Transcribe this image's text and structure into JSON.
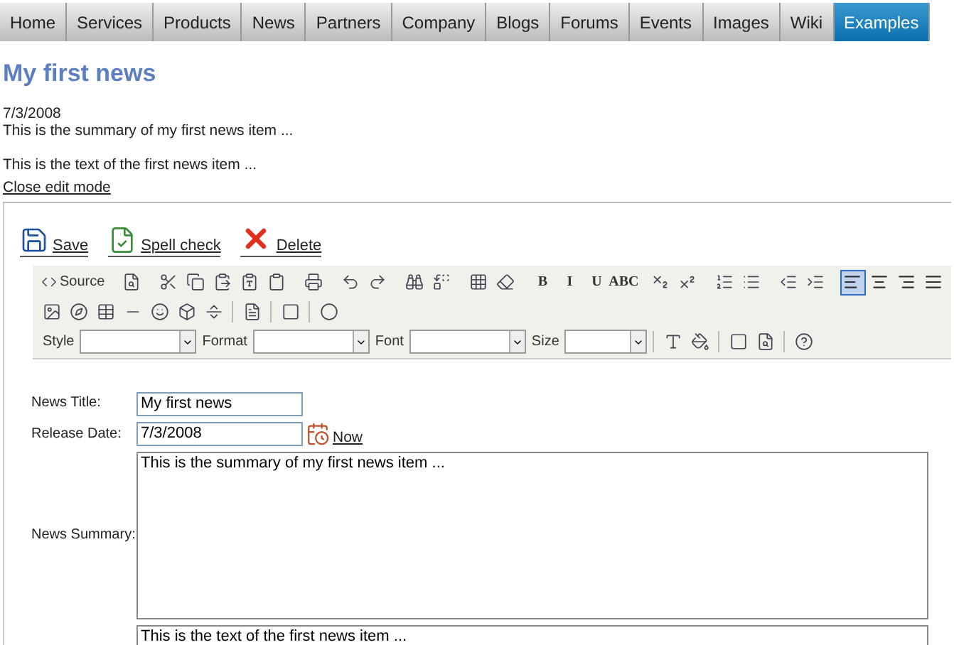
{
  "nav_tabs": [
    {
      "label": "Home",
      "selected": false
    },
    {
      "label": "Services",
      "selected": false
    },
    {
      "label": "Products",
      "selected": false
    },
    {
      "label": "News",
      "selected": false
    },
    {
      "label": "Partners",
      "selected": false
    },
    {
      "label": "Company",
      "selected": false
    },
    {
      "label": "Blogs",
      "selected": false
    },
    {
      "label": "Forums",
      "selected": false
    },
    {
      "label": "Events",
      "selected": false
    },
    {
      "label": "Images",
      "selected": false
    },
    {
      "label": "Wiki",
      "selected": false
    },
    {
      "label": "Examples",
      "selected": true
    }
  ],
  "article": {
    "title": "My first news",
    "date": "7/3/2008",
    "summary": "This is the summary of my first news item ...",
    "text": "This is the text of the first news item ...",
    "close_link": "Close edit mode"
  },
  "actions": [
    {
      "kind": "save",
      "label": "Save"
    },
    {
      "kind": "spell",
      "label": "Spell check"
    },
    {
      "kind": "delete",
      "label": "Delete"
    }
  ],
  "toolbar": {
    "source_label": "Source",
    "format_glyphs": [
      "B",
      "I",
      "U",
      "ABC"
    ],
    "align_buttons": [
      {
        "selected": true
      },
      {
        "selected": false
      },
      {
        "selected": false
      },
      {
        "selected": false
      }
    ],
    "combos": [
      {
        "label": "Style"
      },
      {
        "label": "Format"
      },
      {
        "label": "Font"
      },
      {
        "label": "Size"
      }
    ]
  },
  "form": {
    "title_label": "News Title:",
    "title_value": "My first news",
    "date_label": "Release Date:",
    "date_value": "7/3/2008",
    "now_link": "Now",
    "summary_label": "News Summary:",
    "summary_value": "This is the summary of my first news item ...",
    "text_value": "This is the text of the first news item ..."
  }
}
